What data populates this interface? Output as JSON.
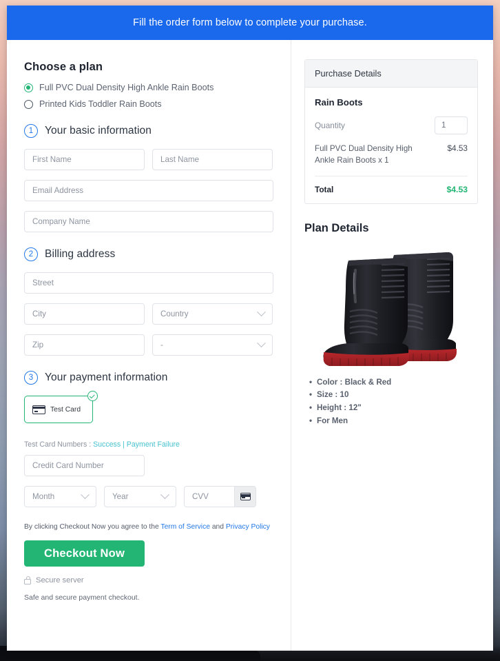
{
  "banner": {
    "text": "Fill the order form below to complete your purchase."
  },
  "plan": {
    "heading": "Choose a plan",
    "options": [
      {
        "label": "Full PVC Dual Density High Ankle Rain Boots",
        "selected": true
      },
      {
        "label": "Printed Kids Toddler Rain Boots",
        "selected": false
      }
    ]
  },
  "steps": {
    "basic": {
      "number": "1",
      "title": "Your basic information"
    },
    "billing": {
      "number": "2",
      "title": "Billing address"
    },
    "payment": {
      "number": "3",
      "title": "Your payment information"
    }
  },
  "fields": {
    "first_name": {
      "placeholder": "First Name",
      "value": ""
    },
    "last_name": {
      "placeholder": "Last Name",
      "value": ""
    },
    "email": {
      "placeholder": "Email Address",
      "value": ""
    },
    "company": {
      "placeholder": "Company Name",
      "value": ""
    },
    "street": {
      "placeholder": "Street",
      "value": ""
    },
    "city": {
      "placeholder": "City",
      "value": ""
    },
    "country": {
      "placeholder": "Country",
      "value": ""
    },
    "zip": {
      "placeholder": "Zip",
      "value": ""
    },
    "state": {
      "placeholder": "-",
      "value": "-"
    },
    "card_number": {
      "placeholder": "Credit Card Number",
      "value": ""
    },
    "month": {
      "placeholder": "Month",
      "value": ""
    },
    "year": {
      "placeholder": "Year",
      "value": ""
    },
    "cvv": {
      "placeholder": "CVV",
      "value": ""
    }
  },
  "payment": {
    "tile_label": "Test  Card",
    "tile_selected": true,
    "test_cards_prefix": "Test Card Numbers : ",
    "success_link": "Success",
    "separator": " | ",
    "failure_link": "Payment Failure"
  },
  "footer": {
    "terms_prefix": "By clicking Checkout Now you agree to the ",
    "terms_link": "Term of Service",
    "terms_mid": " and ",
    "privacy_link": "Privacy Policy",
    "checkout_button": "Checkout Now",
    "secure_server": "Secure server",
    "safe_note": "Safe and secure payment checkout."
  },
  "purchase": {
    "header": "Purchase Details",
    "product": "Rain Boots",
    "quantity_label": "Quantity",
    "quantity_value": "1",
    "line_item": "Full PVC Dual Density High Ankle Rain Boots x 1",
    "line_price": "$4.53",
    "total_label": "Total",
    "total_value": "$4.53"
  },
  "plan_details": {
    "title": "Plan Details",
    "image_alt": "black-rain-boots-with-red-soles",
    "bullets": [
      "Color : Black & Red",
      "Size : 10",
      "Height : 12\"",
      "For Men"
    ]
  },
  "colors": {
    "banner_blue": "#1a68eb",
    "accent_green": "#22b573",
    "link_blue": "#2277e8",
    "link_teal": "#47c2cf",
    "step_blue": "#2277e8"
  }
}
